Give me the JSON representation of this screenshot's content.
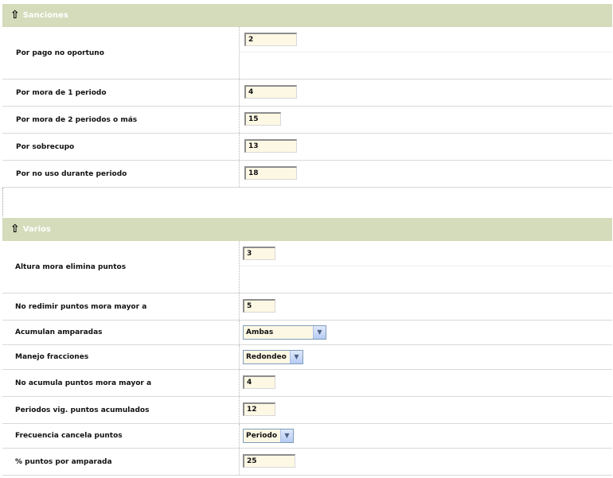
{
  "sanciones": {
    "title": "Sanciones",
    "rows": [
      {
        "label": "Por pago no oportuno",
        "value": "2"
      },
      {
        "label": "Por mora de 1 periodo",
        "value": "4"
      },
      {
        "label": "Por mora de 2 periodos o más",
        "value": "15"
      },
      {
        "label": "Por sobrecupo",
        "value": "13"
      },
      {
        "label": "Por no uso durante periodo",
        "value": "18"
      }
    ]
  },
  "varios": {
    "title": "Varios",
    "rows": [
      {
        "label": "Altura mora elimina puntos",
        "value": "3"
      },
      {
        "label": "No redimir puntos mora mayor a",
        "value": "5"
      },
      {
        "label": "Acumulan amparadas",
        "value": "Ambas"
      },
      {
        "label": "Manejo fracciones",
        "value": "Redondeo"
      },
      {
        "label": "No acumula puntos mora mayor a",
        "value": "4"
      },
      {
        "label": "Periodos vig. puntos acumulados",
        "value": "12"
      },
      {
        "label": "Frecuencia cancela puntos",
        "value": "Periodo"
      },
      {
        "label": "% puntos por amparada",
        "value": "25"
      }
    ]
  },
  "icons": {
    "collapse": "arrow-up-outline-icon",
    "dropdown": "chevron-down-icon"
  },
  "colors": {
    "header_bg": "#d4dcbb",
    "input_bg": "#fdf8e4"
  }
}
